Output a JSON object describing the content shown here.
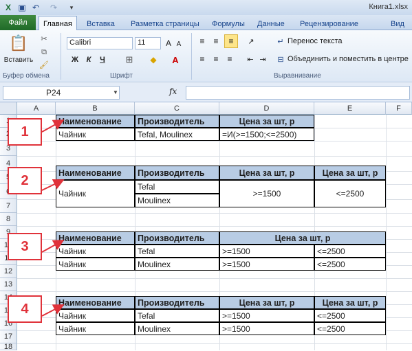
{
  "window": {
    "title": "Книга1.xlsx"
  },
  "tabs": {
    "file": "Файл",
    "items": [
      "Главная",
      "Вставка",
      "Разметка страницы",
      "Формулы",
      "Данные",
      "Рецензирование",
      "Вид"
    ]
  },
  "ribbon": {
    "paste_label": "Вставить",
    "clipboard_label": "Буфер обмена",
    "font_name": "Calibri",
    "font_size": "11",
    "bold": "Ж",
    "italic": "К",
    "underline": "Ч",
    "font_group_label": "Шрифт",
    "wrap_text": "Перенос текста",
    "merge_center": "Объединить и поместить в центре",
    "alignment_label": "Выравнивание"
  },
  "formula_bar": {
    "name_box": "P24",
    "fx": "fx",
    "formula": ""
  },
  "columns": [
    "A",
    "B",
    "C",
    "D",
    "E",
    "F"
  ],
  "rows": [
    "1",
    "2",
    "3",
    "4",
    "5",
    "6",
    "7",
    "8",
    "9",
    "10",
    "11",
    "12",
    "13",
    "14",
    "15",
    "16",
    "17",
    "18"
  ],
  "callouts": [
    "1",
    "2",
    "3",
    "4"
  ],
  "table1": {
    "headers": [
      "Наименование",
      "Производитель",
      "Цена за шт, р"
    ],
    "row": [
      "Чайник",
      "Tefal, Moulinex",
      "=И(>=1500;<=2500)"
    ]
  },
  "table2": {
    "headers": [
      "Наименование",
      "Производитель",
      "Цена за шт, р",
      "Цена за шт, р"
    ],
    "name": "Чайник",
    "makers": [
      "Tefal",
      "Moulinex"
    ],
    "min": ">=1500",
    "max": "<=2500"
  },
  "table3": {
    "headers": [
      "Наименование",
      "Производитель",
      "Цена за шт, р"
    ],
    "rows": [
      [
        "Чайник",
        "Tefal",
        ">=1500",
        "<=2500"
      ],
      [
        "Чайник",
        "Moulinex",
        ">=1500",
        "<=2500"
      ]
    ]
  },
  "table4": {
    "headers": [
      "Наименование",
      "Производитель",
      "Цена за шт, р",
      "Цена за шт, р"
    ],
    "rows": [
      [
        "Чайник",
        "Tefal",
        ">=1500",
        "<=2500"
      ],
      [
        "Чайник",
        "Moulinex",
        ">=1500",
        "<=2500"
      ]
    ]
  }
}
